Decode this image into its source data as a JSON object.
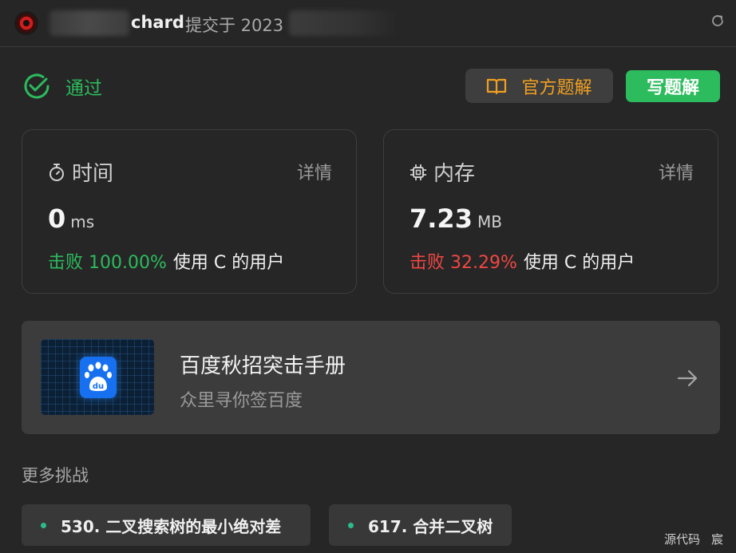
{
  "header": {
    "username_suffix": "chard",
    "submitted_text": "提交于 2023"
  },
  "status": {
    "label": "通过",
    "color": "#2cbb5d"
  },
  "actions": {
    "official_solution": "官方题解",
    "write_solution": "写题解"
  },
  "time_card": {
    "title": "时间",
    "detail": "详情",
    "value": "0",
    "unit": "ms",
    "beat_label": "击败 100.00%",
    "beat_rest": "使用 C 的用户"
  },
  "memory_card": {
    "title": "内存",
    "detail": "详情",
    "value": "7.23",
    "unit": "MB",
    "beat_label": "击败 32.29%",
    "beat_rest": "使用 C 的用户"
  },
  "promo": {
    "title": "百度秋招突击手册",
    "subtitle": "众里寻你签百度",
    "logo_text": "du"
  },
  "more_challenges": {
    "heading": "更多挑战",
    "items": [
      "530. 二叉搜索树的最小绝对差",
      "617. 合并二叉树"
    ]
  },
  "footer": {
    "source_label": "源代码",
    "extra": "宸"
  }
}
